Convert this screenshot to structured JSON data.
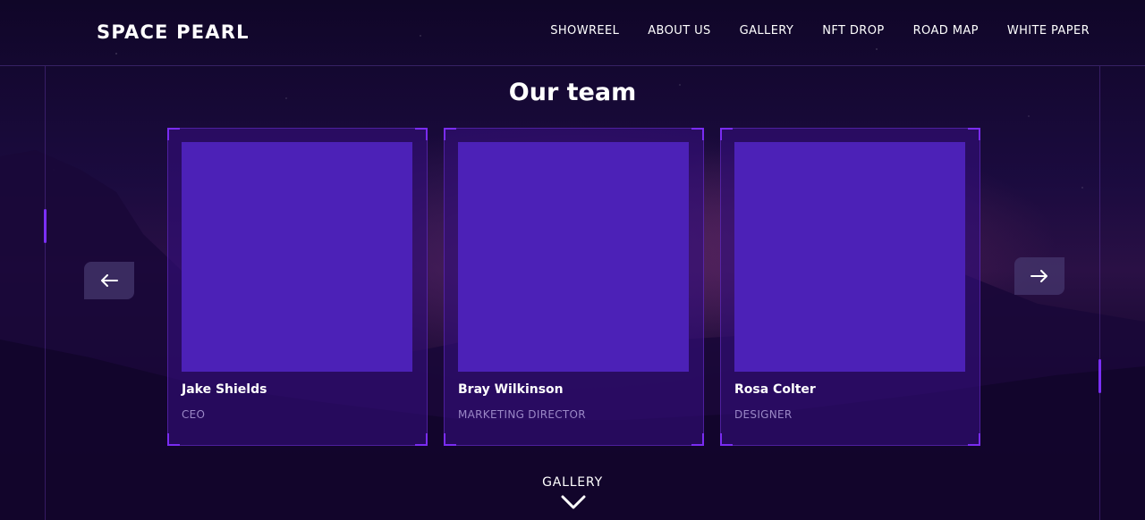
{
  "header": {
    "logo": "SPACE PEARL",
    "nav": [
      {
        "label": "SHOWREEL"
      },
      {
        "label": "ABOUT US"
      },
      {
        "label": "GALLERY"
      },
      {
        "label": "NFT DROP"
      },
      {
        "label": "ROAD MAP"
      },
      {
        "label": "WHITE PAPER"
      }
    ]
  },
  "team": {
    "title": "Our team",
    "members": [
      {
        "name": "Jake Shields",
        "role": "CEO"
      },
      {
        "name": "Bray Wilkinson",
        "role": "MARKETING DIRECTOR"
      },
      {
        "name": "Rosa Colter",
        "role": "DESIGNER"
      }
    ],
    "prev_icon": "arrow-left-icon",
    "next_icon": "arrow-right-icon"
  },
  "footer_link": {
    "label": "GALLERY",
    "icon": "chevron-down-icon"
  },
  "colors": {
    "background": "#0f0627",
    "card": "#340e7a",
    "photo_placeholder": "#4c21b7",
    "accent": "#7a2cf2",
    "role_text": "#9a87c6"
  }
}
